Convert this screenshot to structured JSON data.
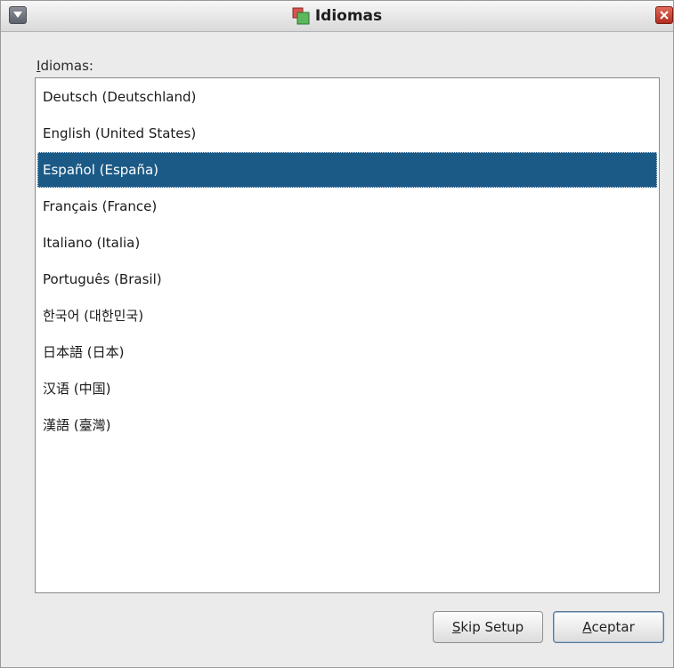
{
  "window": {
    "title": "Idiomas"
  },
  "list": {
    "label_first": "I",
    "label_rest": "diomas:",
    "selected_index": 2,
    "items": [
      "Deutsch (Deutschland)",
      "English (United States)",
      "Español (España)",
      "Français (France)",
      "Italiano (Italia)",
      "Português (Brasil)",
      "한국어 (대한민국)",
      "日本語 (日本)",
      "汉语 (中国)",
      "漢語 (臺灣)"
    ]
  },
  "buttons": {
    "skip_mnemonic": "S",
    "skip_rest": "kip Setup",
    "ok_mnemonic": "A",
    "ok_rest": "ceptar"
  },
  "colors": {
    "selection": "#1b5a87",
    "close": "#c0392b"
  }
}
